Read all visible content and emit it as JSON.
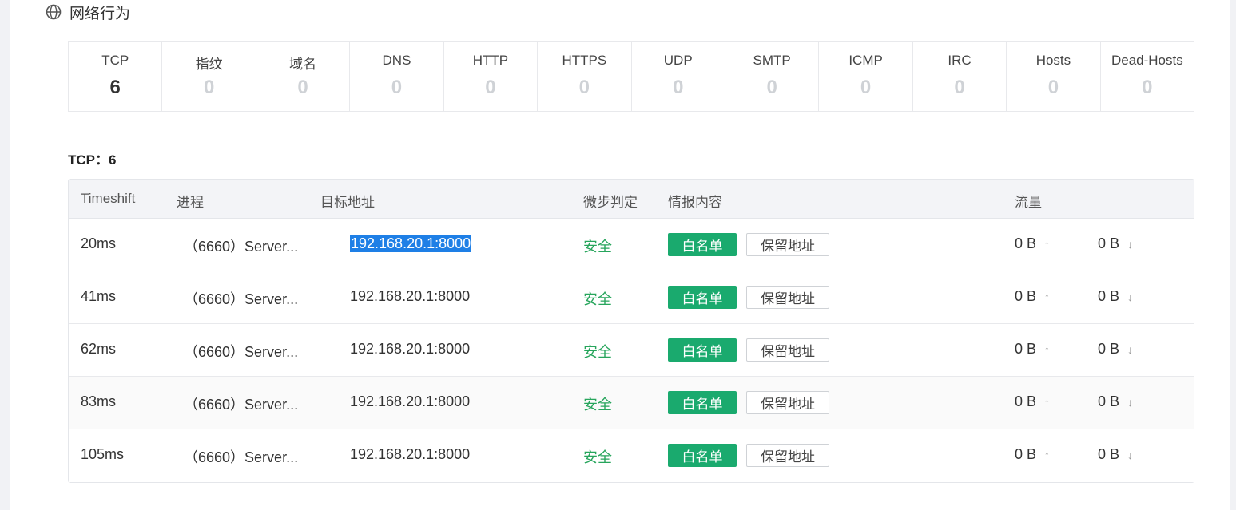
{
  "section": {
    "title": "网络行为",
    "icon": "globe-icon"
  },
  "stats": [
    {
      "label": "TCP",
      "count": "6",
      "active": true
    },
    {
      "label": "指纹",
      "count": "0"
    },
    {
      "label": "域名",
      "count": "0"
    },
    {
      "label": "DNS",
      "count": "0"
    },
    {
      "label": "HTTP",
      "count": "0"
    },
    {
      "label": "HTTPS",
      "count": "0"
    },
    {
      "label": "UDP",
      "count": "0"
    },
    {
      "label": "SMTP",
      "count": "0"
    },
    {
      "label": "ICMP",
      "count": "0"
    },
    {
      "label": "IRC",
      "count": "0"
    },
    {
      "label": "Hosts",
      "count": "0"
    },
    {
      "label": "Dead-Hosts",
      "count": "0"
    }
  ],
  "subtitle": "TCP：6",
  "table": {
    "headers": {
      "timeshift": "Timeshift",
      "process": "进程",
      "dest": "目标地址",
      "verdict": "微步判定",
      "intel": "情报内容",
      "traffic": "流量"
    },
    "rows": [
      {
        "time": "20ms",
        "process": "（6660）Server...",
        "dest": "192.168.20.1:8000",
        "verdict": "安全",
        "tag1": "白名单",
        "tag2": "保留地址",
        "up": "0 B",
        "down": "0 B"
      },
      {
        "time": "41ms",
        "process": "（6660）Server...",
        "dest": "192.168.20.1:8000",
        "verdict": "安全",
        "tag1": "白名单",
        "tag2": "保留地址",
        "up": "0 B",
        "down": "0 B"
      },
      {
        "time": "62ms",
        "process": "（6660）Server...",
        "dest": "192.168.20.1:8000",
        "verdict": "安全",
        "tag1": "白名单",
        "tag2": "保留地址",
        "up": "0 B",
        "down": "0 B"
      },
      {
        "time": "83ms",
        "process": "（6660）Server...",
        "dest": "192.168.20.1:8000",
        "verdict": "安全",
        "tag1": "白名单",
        "tag2": "保留地址",
        "up": "0 B",
        "down": "0 B"
      },
      {
        "time": "105ms",
        "process": "（6660）Server...",
        "dest": "192.168.20.1:8000",
        "verdict": "安全",
        "tag1": "白名单",
        "tag2": "保留地址",
        "up": "0 B",
        "down": "0 B"
      }
    ]
  },
  "colors": {
    "accent_green": "#1aaa6e",
    "safe_text": "#27a55c",
    "selection": "#1e7fe6"
  }
}
